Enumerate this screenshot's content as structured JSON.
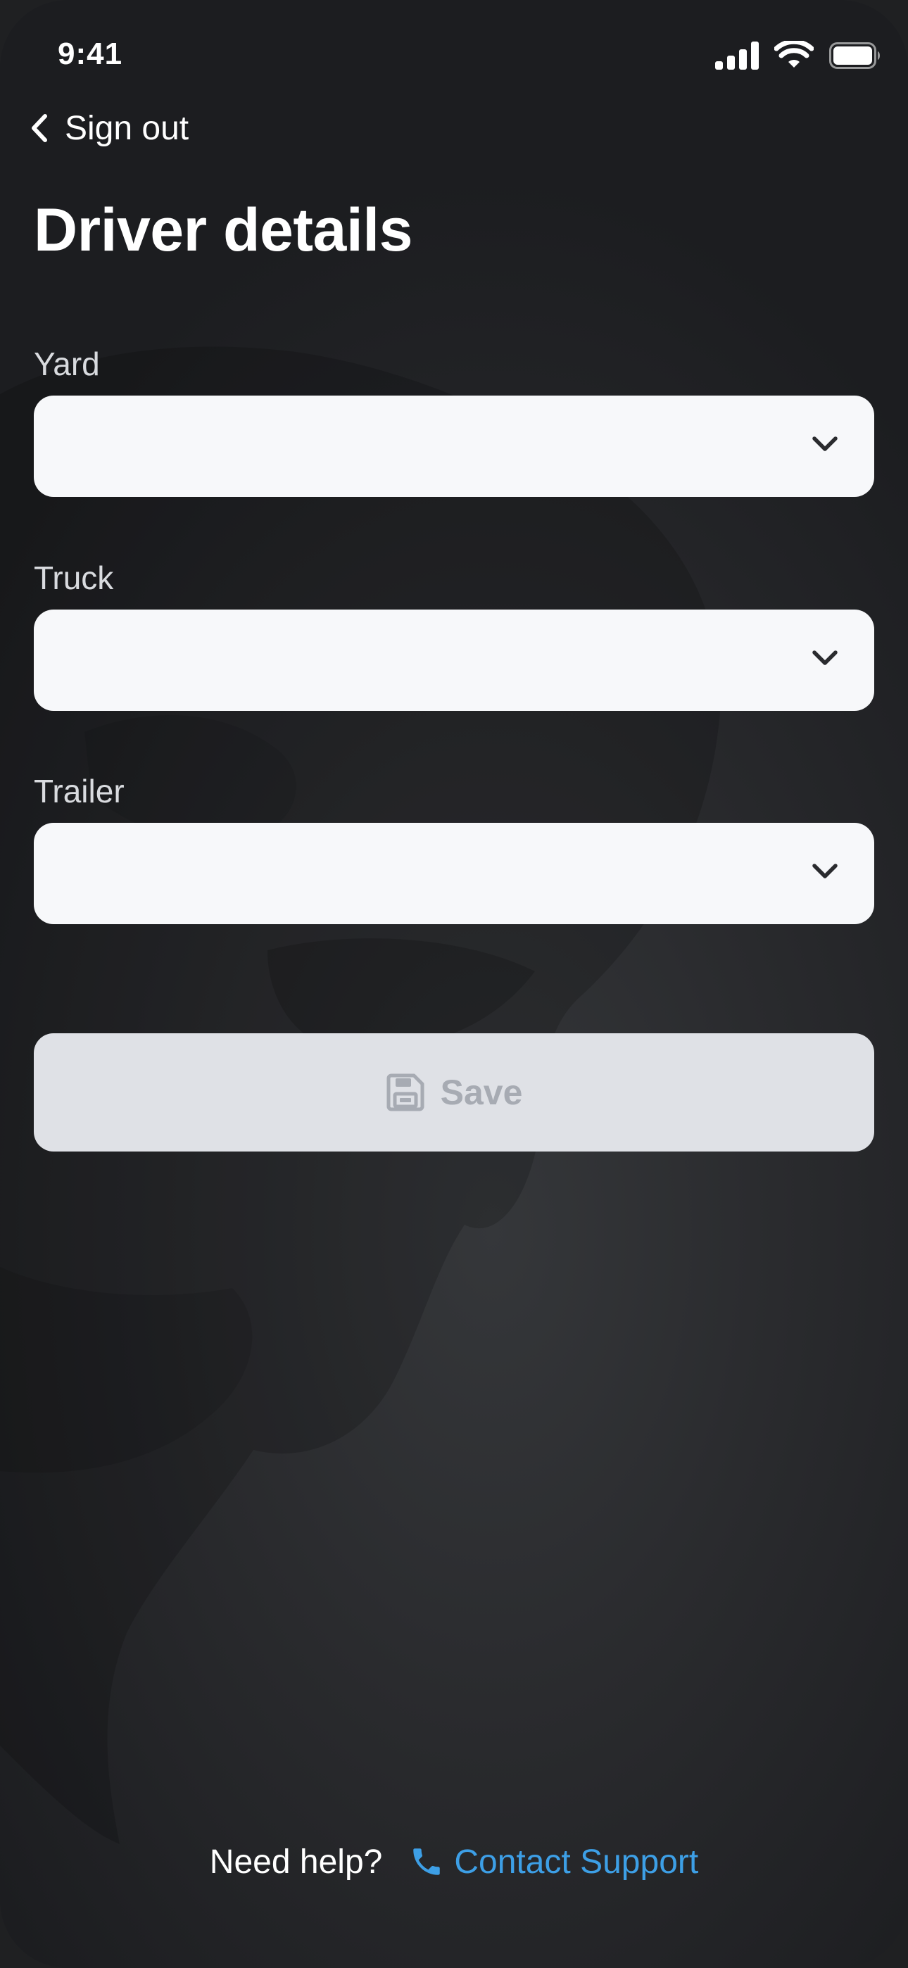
{
  "status_bar": {
    "time": "9:41",
    "icons": [
      "signal-icon",
      "wifi-icon",
      "battery-icon"
    ]
  },
  "nav": {
    "back_label": "Sign out"
  },
  "page": {
    "title": "Driver details"
  },
  "form": {
    "fields": [
      {
        "label": "Yard",
        "value": ""
      },
      {
        "label": "Truck",
        "value": ""
      },
      {
        "label": "Trailer",
        "value": ""
      }
    ],
    "save_label": "Save",
    "save_enabled": false
  },
  "footer": {
    "help_text": "Need help?",
    "support_label": "Contact Support"
  },
  "colors": {
    "background": "#2a2b2e",
    "field_background": "#f7f8fa",
    "button_disabled": "#dfe1e6",
    "button_disabled_text": "#a7abb3",
    "link": "#3d9fe6"
  }
}
